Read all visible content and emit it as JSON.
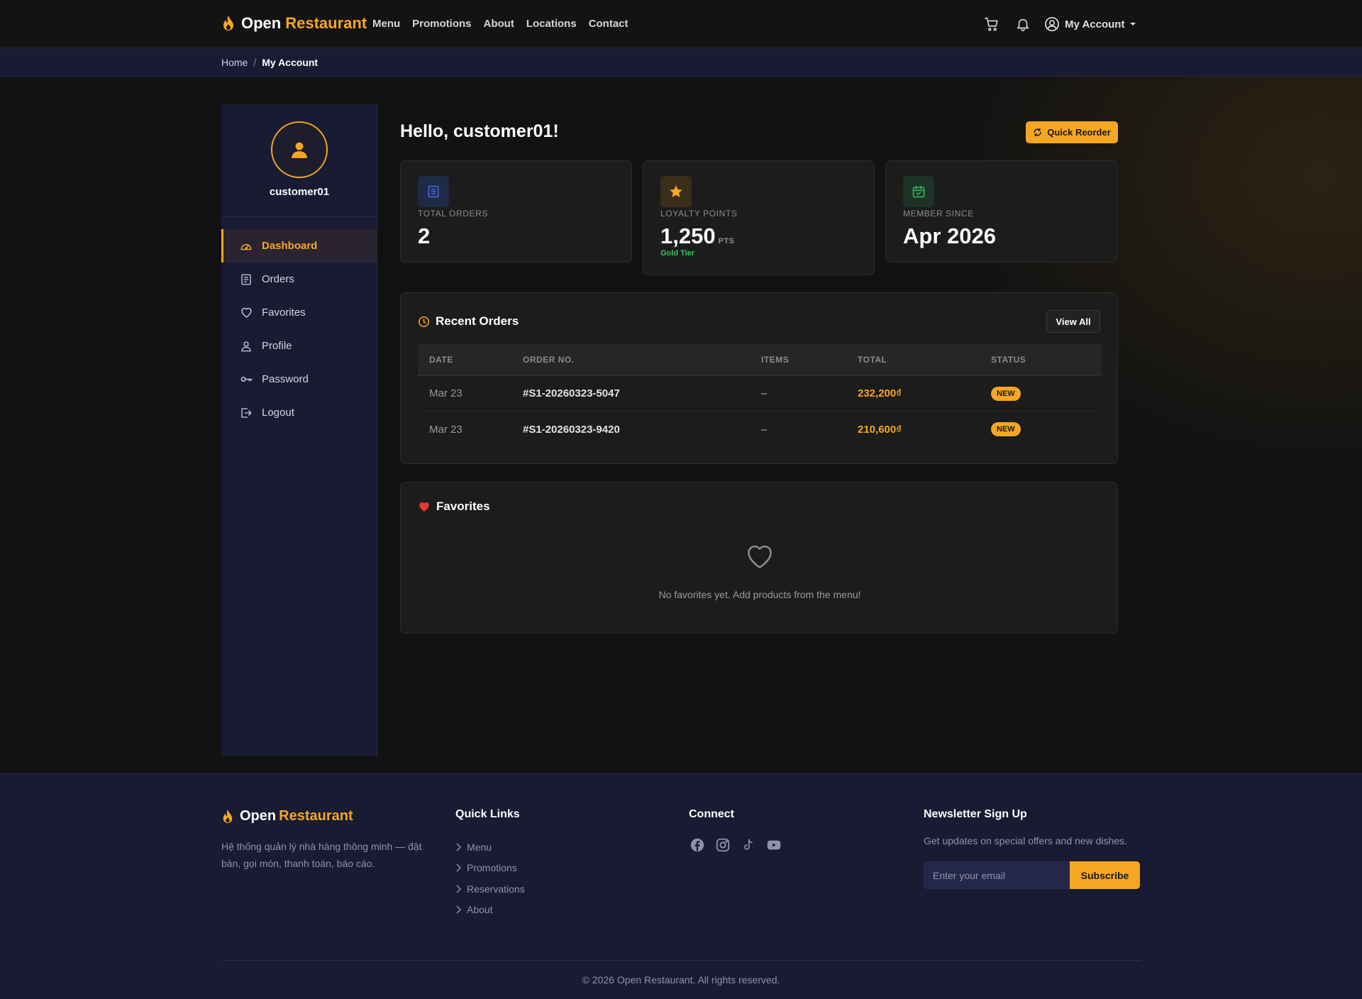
{
  "brand": {
    "word1": "Open",
    "word2": "Restaurant"
  },
  "nav": {
    "links": [
      "Menu",
      "Promotions",
      "About",
      "Locations",
      "Contact"
    ],
    "account_label": "My Account"
  },
  "breadcrumb": {
    "home": "Home",
    "separator": "/",
    "current": "My Account"
  },
  "sidebar": {
    "username": "customer01",
    "items": [
      {
        "label": "Dashboard",
        "icon": "dashboard-icon",
        "active": true
      },
      {
        "label": "Orders",
        "icon": "receipt-icon"
      },
      {
        "label": "Favorites",
        "icon": "heart-icon"
      },
      {
        "label": "Profile",
        "icon": "person-icon"
      },
      {
        "label": "Password",
        "icon": "key-icon"
      },
      {
        "label": "Logout",
        "icon": "logout-icon"
      }
    ]
  },
  "dashboard": {
    "greeting": "Hello, customer01!",
    "quick_reorder": "Quick Reorder",
    "stats": [
      {
        "label": "TOTAL ORDERS",
        "value": "2",
        "icon": "receipt-icon",
        "color": "#3b6ad6"
      },
      {
        "label": "LOYALTY POINTS",
        "value": "1,250",
        "unit": "PTS",
        "tier": "Gold Tier",
        "icon": "star-icon",
        "color": "#f5a623"
      },
      {
        "label": "MEMBER SINCE",
        "value": "Apr 2026",
        "icon": "calendar-check-icon",
        "color": "#2fb35a"
      }
    ]
  },
  "recent_orders": {
    "title": "Recent Orders",
    "view_all": "View All",
    "columns": [
      "DATE",
      "ORDER NO.",
      "ITEMS",
      "TOTAL",
      "STATUS"
    ],
    "rows": [
      {
        "date": "Mar 23",
        "order_no": "#S1-20260323-5047",
        "items": "–",
        "total": "232,200₫",
        "status": "NEW"
      },
      {
        "date": "Mar 23",
        "order_no": "#S1-20260323-9420",
        "items": "–",
        "total": "210,600₫",
        "status": "NEW"
      }
    ]
  },
  "favorites": {
    "title": "Favorites",
    "empty_text": "No favorites yet. Add products from the menu!"
  },
  "footer": {
    "description": "Hệ thống quản lý nhà hàng thông minh — đặt bàn, gọi món, thanh toán, báo cáo.",
    "quick_links_title": "Quick Links",
    "quick_links": [
      "Menu",
      "Promotions",
      "Reservations",
      "About"
    ],
    "connect_title": "Connect",
    "social": [
      "facebook-icon",
      "instagram-icon",
      "tiktok-icon",
      "youtube-icon"
    ],
    "newsletter_title": "Newsletter Sign Up",
    "newsletter_text": "Get updates on special offers and new dishes.",
    "email_placeholder": "Enter your email",
    "subscribe": "Subscribe",
    "copyright": "© 2026 Open Restaurant. All rights reserved."
  },
  "colors": {
    "accent": "#f5a623",
    "success": "#34c759",
    "panel": "#191b33",
    "card": "#1c1c1c"
  }
}
